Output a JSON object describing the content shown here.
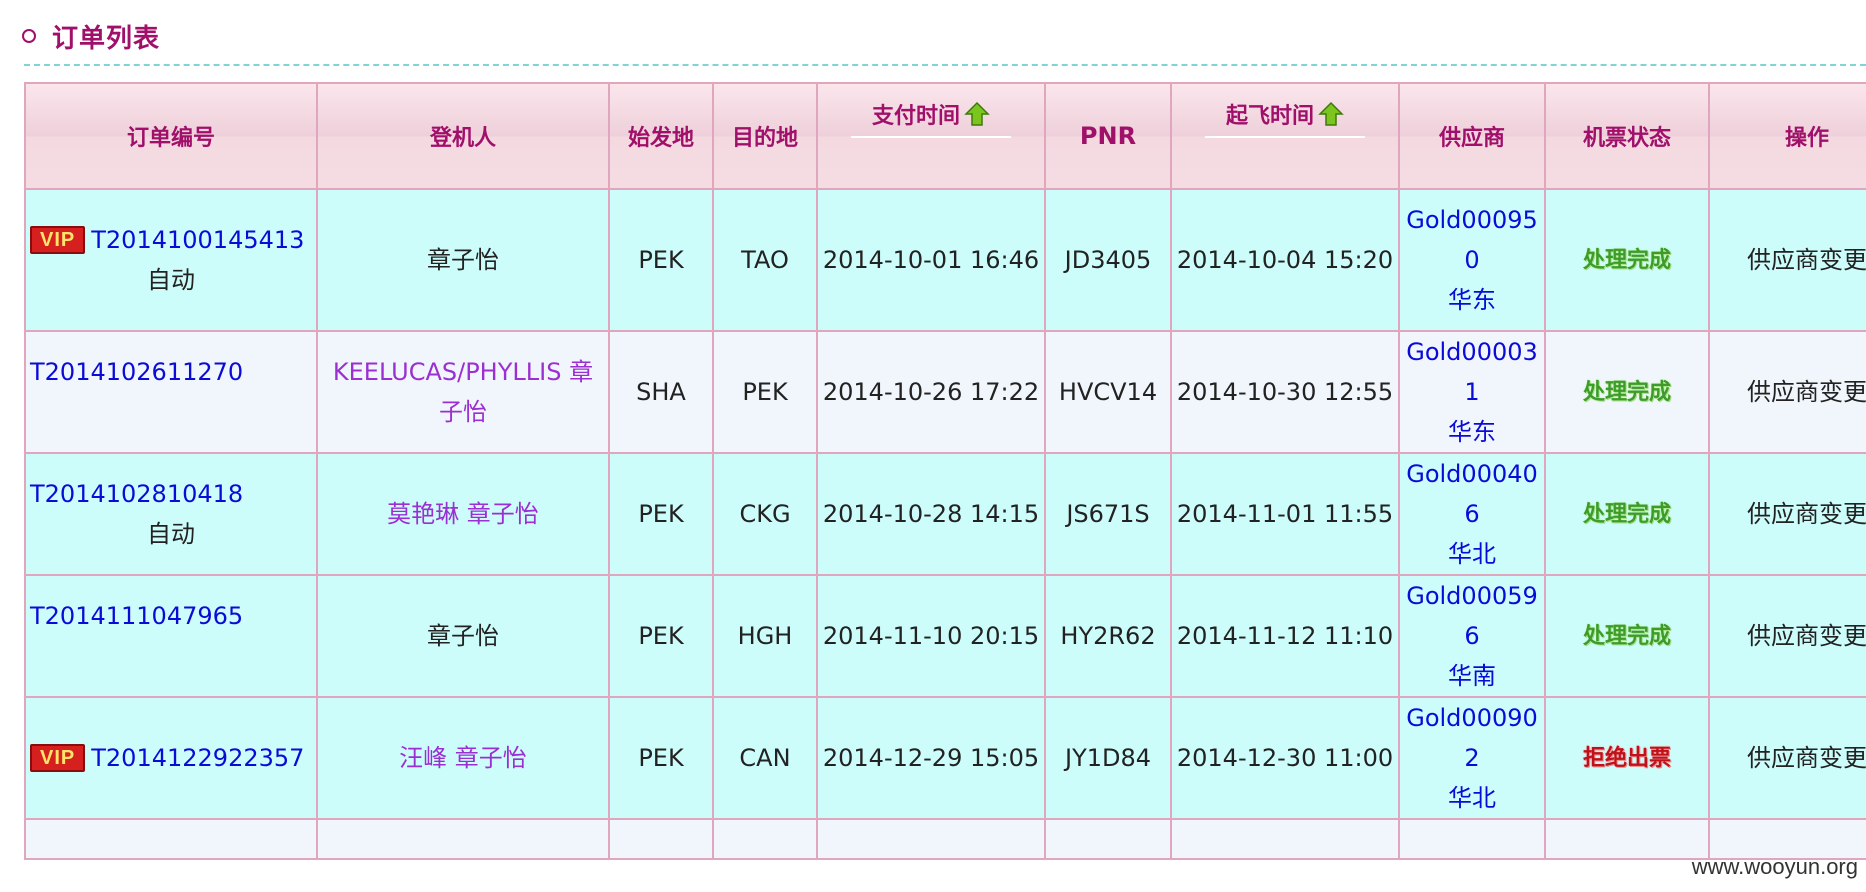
{
  "header": {
    "title": "订单列表"
  },
  "columns": {
    "order_no": "订单编号",
    "passenger": "登机人",
    "origin": "始发地",
    "destination": "目的地",
    "pay_time": "支付时间",
    "pnr": "PNR",
    "depart_time": "起飞时间",
    "supplier": "供应商",
    "ticket_status": "机票状态",
    "action": "操作"
  },
  "rows": [
    {
      "vip": "VIP",
      "order_no": "T2014100145413",
      "order_extra": "自动",
      "passenger": "章子怡",
      "origin": "PEK",
      "destination": "TAO",
      "pay_time": "2014-10-01 16:46",
      "pnr": "JD3405",
      "depart_time": "2014-10-04 15:20",
      "supplier_code": "Gold000950",
      "supplier_region": "华东",
      "status": "处理完成",
      "action": "供应商变更"
    },
    {
      "vip": "",
      "order_no": "T2014102611270",
      "order_extra": "",
      "passenger": "KEELUCAS/PHYLLIS 章子怡",
      "origin": "SHA",
      "destination": "PEK",
      "pay_time": "2014-10-26 17:22",
      "pnr": "HVCV14",
      "depart_time": "2014-10-30 12:55",
      "supplier_code": "Gold000031",
      "supplier_region": "华东",
      "status": "处理完成",
      "action": "供应商变更"
    },
    {
      "vip": "",
      "order_no": "T2014102810418",
      "order_extra": "自动",
      "passenger": "莫艳琳 章子怡",
      "origin": "PEK",
      "destination": "CKG",
      "pay_time": "2014-10-28 14:15",
      "pnr": "JS671S",
      "depart_time": "2014-11-01 11:55",
      "supplier_code": "Gold000406",
      "supplier_region": "华北",
      "status": "处理完成",
      "action": "供应商变更"
    },
    {
      "vip": "",
      "order_no": "T2014111047965",
      "order_extra": "",
      "passenger": "章子怡",
      "origin": "PEK",
      "destination": "HGH",
      "pay_time": "2014-11-10 20:15",
      "pnr": "HY2R62",
      "depart_time": "2014-11-12 11:10",
      "supplier_code": "Gold000596",
      "supplier_region": "华南",
      "status": "处理完成",
      "action": "供应商变更"
    },
    {
      "vip": "VIP",
      "order_no": "T2014122922357",
      "order_extra": "",
      "passenger": "汪峰 章子怡",
      "origin": "PEK",
      "destination": "CAN",
      "pay_time": "2014-12-29 15:05",
      "pnr": "JY1D84",
      "depart_time": "2014-12-30 11:00",
      "supplier_code": "Gold000902",
      "supplier_region": "华北",
      "status": "拒绝出票",
      "action": "供应商变更"
    }
  ],
  "watermark": "www.wooyun.org",
  "colors": {
    "accent": "#a0106a",
    "link": "#0b0bd8",
    "row_cyan": "#ccfdfb",
    "status_ok": "#3c9c2a",
    "status_rejected": "#c0101a"
  },
  "icons": {
    "sort": "green-up-arrow-icon",
    "bullet": "circle-bullet-icon"
  }
}
